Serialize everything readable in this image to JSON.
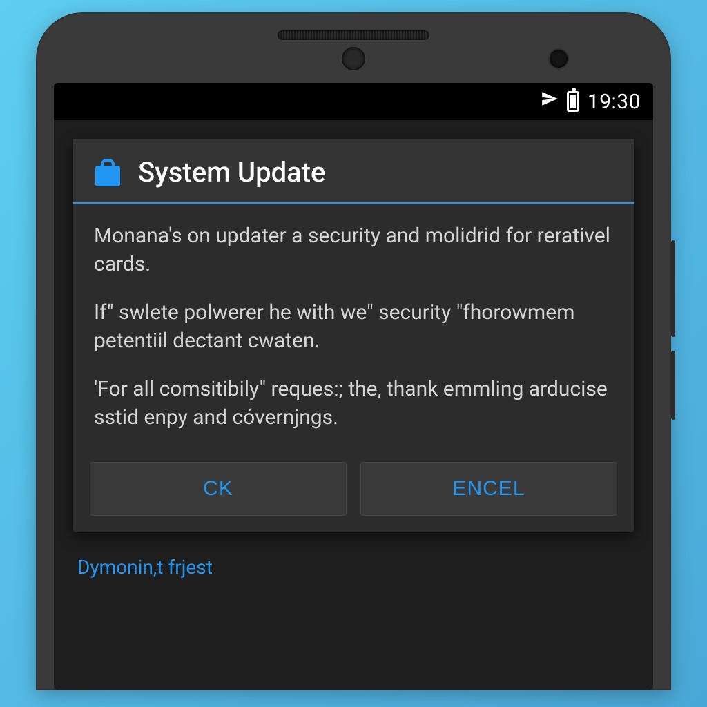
{
  "status": {
    "time": "19:30"
  },
  "dialog": {
    "title": "System Update",
    "paragraphs": [
      "Monana's on updater a security and molidrid for rerativel cards.",
      "If\" swlete polwerer he with we\" security \"fhorowmem petentiil dectant cwaten.",
      "'For all comsitibily\" reques:; the, thank emmling arducise sstid enpy and cóvernjngs."
    ],
    "buttons": {
      "ok": "CK",
      "cancel": "ENCEL"
    }
  },
  "footer": {
    "link": "Dymonin,t frjest"
  },
  "colors": {
    "accent": "#2196f3",
    "dialog_bg": "#2c2c2c",
    "screen_bg": "#1e1e1e"
  }
}
